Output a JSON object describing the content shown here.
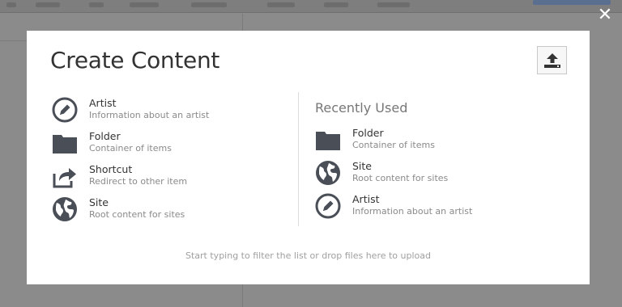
{
  "modal": {
    "title": "Create Content",
    "upload_icon": "upload-icon",
    "close_icon": "close-icon",
    "hint": "Start typing to filter the list or drop files here to upload"
  },
  "all_types": [
    {
      "icon": "pencil-icon",
      "name": "Artist",
      "desc": "Information about an artist"
    },
    {
      "icon": "folder-icon",
      "name": "Folder",
      "desc": "Container of items"
    },
    {
      "icon": "share-icon",
      "name": "Shortcut",
      "desc": "Redirect to other item"
    },
    {
      "icon": "globe-icon",
      "name": "Site",
      "desc": "Root content for sites"
    }
  ],
  "recently_used": {
    "title": "Recently Used",
    "items": [
      {
        "icon": "folder-icon",
        "name": "Folder",
        "desc": "Container of items"
      },
      {
        "icon": "globe-icon",
        "name": "Site",
        "desc": "Root content for sites"
      },
      {
        "icon": "pencil-icon",
        "name": "Artist",
        "desc": "Information about an artist"
      }
    ]
  },
  "colors": {
    "icon": "#4a4e57",
    "overlay": "#8b8b8b",
    "modal_bg": "#ffffff"
  }
}
